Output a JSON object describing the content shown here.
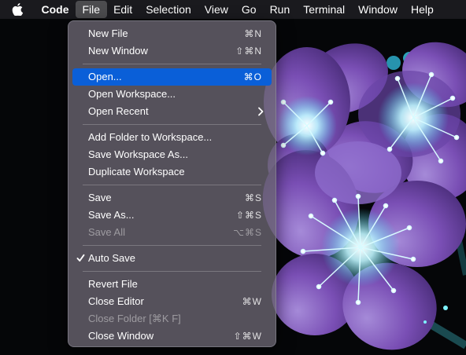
{
  "menubar": {
    "app_name": "Code",
    "items": [
      "File",
      "Edit",
      "Selection",
      "View",
      "Go",
      "Run",
      "Terminal",
      "Window",
      "Help"
    ]
  },
  "file_menu": {
    "new_file": {
      "label": "New File",
      "shortcut": "⌘N"
    },
    "new_window": {
      "label": "New Window",
      "shortcut": "⇧⌘N"
    },
    "open": {
      "label": "Open...",
      "shortcut": "⌘O"
    },
    "open_workspace": {
      "label": "Open Workspace..."
    },
    "open_recent": {
      "label": "Open Recent"
    },
    "add_folder": {
      "label": "Add Folder to Workspace..."
    },
    "save_workspace_as": {
      "label": "Save Workspace As..."
    },
    "duplicate_workspace": {
      "label": "Duplicate Workspace"
    },
    "save": {
      "label": "Save",
      "shortcut": "⌘S"
    },
    "save_as": {
      "label": "Save As...",
      "shortcut": "⇧⌘S"
    },
    "save_all": {
      "label": "Save All",
      "shortcut": "⌥⌘S"
    },
    "auto_save": {
      "label": "Auto Save",
      "checked": true
    },
    "revert_file": {
      "label": "Revert File"
    },
    "close_editor": {
      "label": "Close Editor",
      "shortcut": "⌘W"
    },
    "close_folder": {
      "label": "Close Folder [⌘K F]"
    },
    "close_window": {
      "label": "Close Window",
      "shortcut": "⇧⌘W"
    }
  },
  "colors": {
    "highlight": "#0a5fd8",
    "menubar_bg": "#1c1c20",
    "wallpaper_petal": "#7a4fb5",
    "wallpaper_glow": "#43e0f0"
  }
}
